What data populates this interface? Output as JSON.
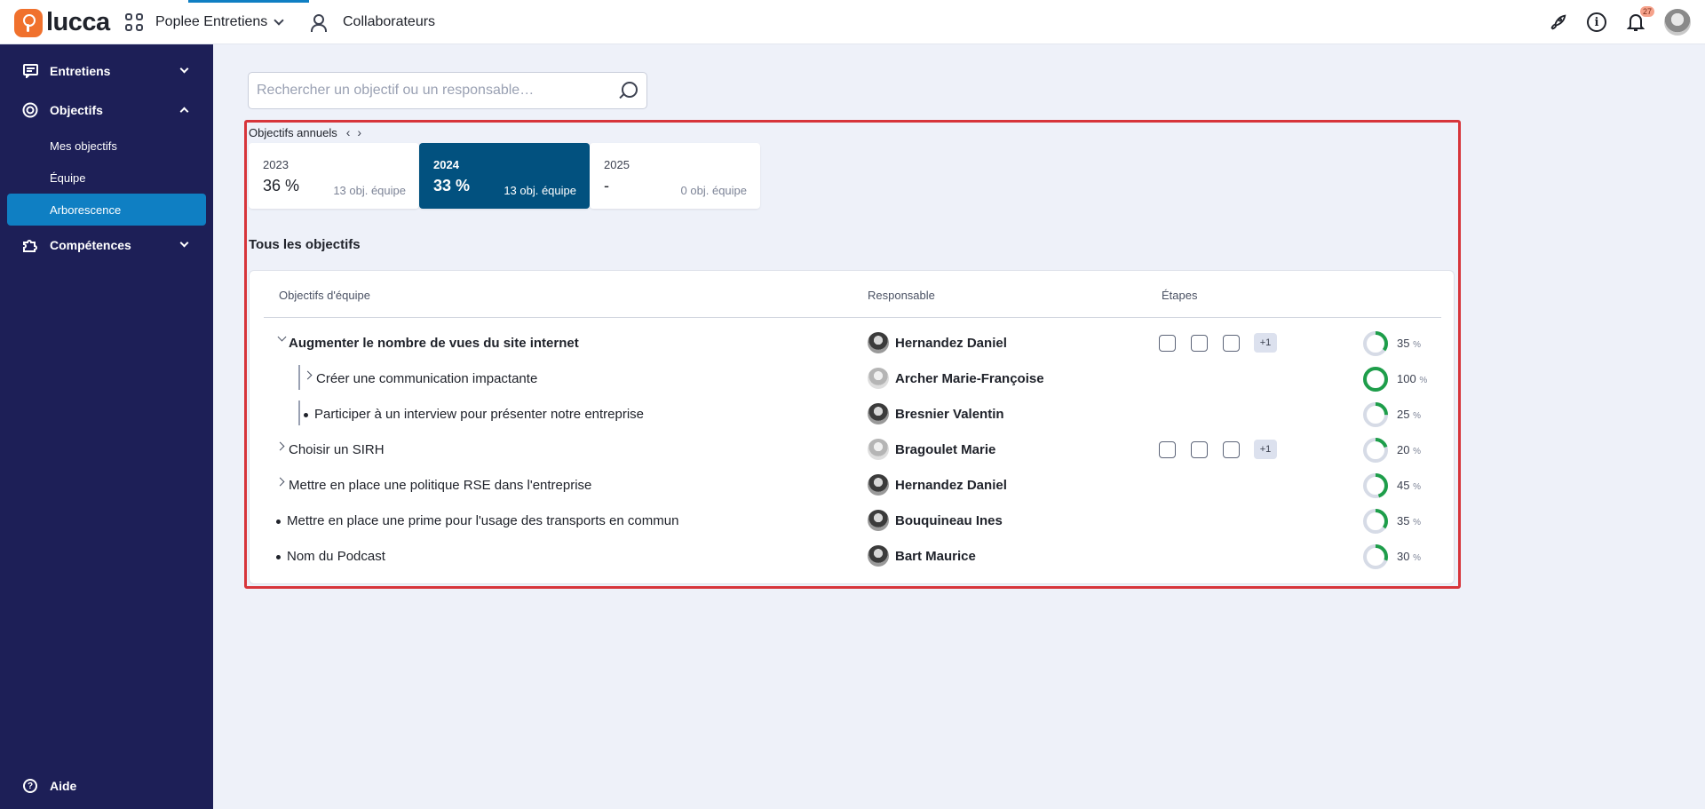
{
  "topbar": {
    "logo_text": "lucca",
    "app_name": "Poplee Entretiens",
    "collaborators_label": "Collaborateurs",
    "notifications_count": "27",
    "icons": [
      "apps-grid-icon",
      "people-icon",
      "rocket-icon",
      "info-icon",
      "bell-icon",
      "user-avatar"
    ]
  },
  "sidebar": {
    "items": [
      {
        "label": "Entretiens",
        "icon": "chat-icon",
        "expanded": false
      },
      {
        "label": "Objectifs",
        "icon": "target-icon",
        "expanded": true
      },
      {
        "label": "Compétences",
        "icon": "puzzle-icon",
        "expanded": false
      }
    ],
    "subitems": [
      {
        "label": "Mes objectifs",
        "active": false
      },
      {
        "label": "Équipe",
        "active": false
      },
      {
        "label": "Arborescence",
        "active": true
      }
    ],
    "help_label": "Aide"
  },
  "search": {
    "placeholder": "Rechercher un objectif ou un responsable…",
    "value": ""
  },
  "annual": {
    "title": "Objectifs annuels",
    "prev": "‹",
    "next": "›",
    "years": [
      {
        "year": "2023",
        "percent": "36 %",
        "count": "13 obj. équipe",
        "active": false
      },
      {
        "year": "2024",
        "percent": "33 %",
        "count": "13 obj. équipe",
        "active": true
      },
      {
        "year": "2025",
        "percent": "-",
        "count": "0 obj. équipe",
        "active": false
      }
    ]
  },
  "objectives": {
    "section_title": "Tous les objectifs",
    "headers": {
      "objective": "Objectifs d'équipe",
      "owner": "Responsable",
      "steps": "Étapes"
    },
    "plus_label": "+1",
    "percent_unit": "%",
    "rows": [
      {
        "title": "Augmenter le nombre de vues du site internet",
        "owner": "Hernandez Daniel",
        "progress": 35,
        "progress_label": "35",
        "steps": true
      },
      {
        "title": "Créer une communication impactante",
        "owner": "Archer Marie-Françoise",
        "progress": 100,
        "progress_label": "100",
        "steps": false
      },
      {
        "title": "Participer à un interview pour présenter notre entreprise",
        "owner": "Bresnier Valentin",
        "progress": 25,
        "progress_label": "25",
        "steps": false
      },
      {
        "title": "Choisir un SIRH",
        "owner": "Bragoulet Marie",
        "progress": 20,
        "progress_label": "20",
        "steps": true
      },
      {
        "title": "Mettre en place une politique RSE dans l'entreprise",
        "owner": "Hernandez Daniel",
        "progress": 45,
        "progress_label": "45",
        "steps": false
      },
      {
        "title": "Mettre en place une prime pour l'usage des transports en commun",
        "owner": "Bouquineau Ines",
        "progress": 35,
        "progress_label": "35",
        "steps": false
      },
      {
        "title": "Nom du Podcast",
        "owner": "Bart Maurice",
        "progress": 30,
        "progress_label": "30",
        "steps": false
      }
    ]
  },
  "colors": {
    "sidebar_bg": "#1d1f57",
    "active_blue": "#0f7fc3",
    "year_active_bg": "#02517f",
    "progress_green": "#1e9e4a",
    "progress_track": "#d6dbe6",
    "highlight_red": "#d7353b"
  }
}
